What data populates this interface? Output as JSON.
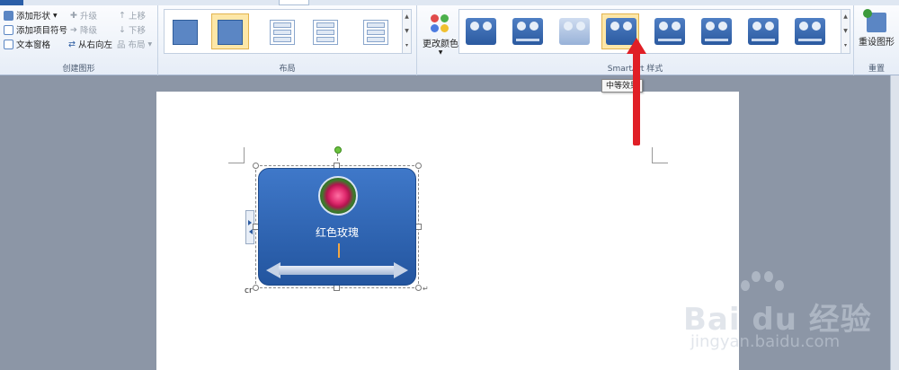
{
  "ribbon": {
    "create_graphic": {
      "label": "创建图形",
      "add_shape": "添加形状",
      "add_bullet": "添加项目符号",
      "text_pane": "文本窗格",
      "promote": "升级",
      "demote": "降级",
      "right_to_left": "从右向左",
      "move_up": "上移",
      "move_down": "下移",
      "layout": "布局"
    },
    "layouts": {
      "label": "布局"
    },
    "smartart_styles": {
      "label": "SmartArt 样式",
      "change_colors": "更改颜色",
      "selected_index": 3
    },
    "reset": {
      "label": "重置",
      "reset_graphic": "重设图形"
    }
  },
  "tooltip": {
    "text": "中等效果"
  },
  "document": {
    "flower_text": "红色玫瑰",
    "cr_text": "cr",
    "para_mark": "↵"
  },
  "watermark": {
    "brand": "Bai du 经验",
    "url": "jingyan.baidu.com"
  },
  "colors": {
    "accent_blue": "#2b5aa0",
    "annotation_red": "#e01f26",
    "selection_gold": "#e3b34e"
  }
}
